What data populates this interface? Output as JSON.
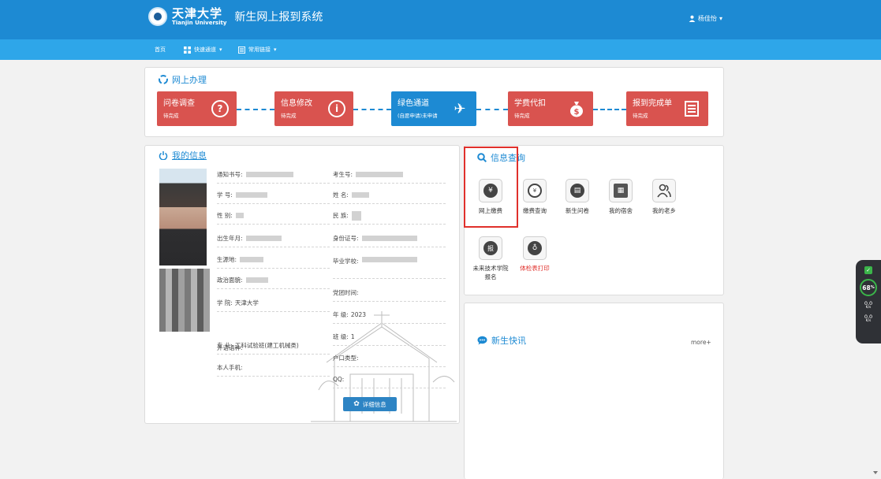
{
  "header": {
    "logo_cn": "天津大学",
    "logo_en": "Tianjin University",
    "system_title": "新生网上报到系统",
    "user_name": "杨佳怡"
  },
  "nav": {
    "home": "首页",
    "quick": "快速通道",
    "links": "常用链接"
  },
  "online": {
    "title": "网上办理",
    "steps": [
      {
        "label": "问卷调查",
        "status": "待完成",
        "icon": "question-icon",
        "color": "#d9534f"
      },
      {
        "label": "信息修改",
        "status": "待完成",
        "icon": "info-icon",
        "color": "#d9534f"
      },
      {
        "label": "绿色通道",
        "status": "(自愿申请)未申请",
        "icon": "airplane-icon",
        "color": "#1d8ad3"
      },
      {
        "label": "学费代扣",
        "status": "待完成",
        "icon": "money-bag-icon",
        "color": "#d9534f"
      },
      {
        "label": "报到完成单",
        "status": "待完成",
        "icon": "list-icon",
        "color": "#d9534f"
      }
    ]
  },
  "myinfo": {
    "title": "我的信息",
    "left_fields": [
      {
        "label": "通知书号:",
        "value": ""
      },
      {
        "label": "学 号:",
        "value": ""
      },
      {
        "label": "性 别:",
        "value": ""
      },
      {
        "label": "出生年月:",
        "value": ""
      },
      {
        "label": "生源地:",
        "value": ""
      },
      {
        "label": "政治面貌:",
        "value": ""
      },
      {
        "label": "学 院:",
        "value": "天津大学"
      },
      {
        "label": "专 业:",
        "value": "工科试验班(建工机械类)"
      },
      {
        "label": "外语语种:",
        "value": ""
      },
      {
        "label": "本人手机:",
        "value": ""
      }
    ],
    "right_fields": [
      {
        "label": "考生号:",
        "value": ""
      },
      {
        "label": "姓 名:",
        "value": ""
      },
      {
        "label": "民 族:",
        "value": ""
      },
      {
        "label": "身份证号:",
        "value": ""
      },
      {
        "label": "毕业学校:",
        "value": ""
      },
      {
        "label": "党团时间:",
        "value": ""
      },
      {
        "label": "年 级:",
        "value": "2023"
      },
      {
        "label": "班 级:",
        "value": "1"
      },
      {
        "label": "户口类型:",
        "value": ""
      },
      {
        "label": "QQ:",
        "value": ""
      }
    ],
    "detail_button": "详细信息"
  },
  "query": {
    "title": "信息查询",
    "services": [
      {
        "label": "网上缴费",
        "icon": "yen-coin-icon",
        "label_color": "#333333"
      },
      {
        "label": "缴费查询",
        "icon": "search-yen-icon",
        "label_color": "#333333"
      },
      {
        "label": "新生问卷",
        "icon": "document-icon",
        "label_color": "#333333"
      },
      {
        "label": "我的宿舍",
        "icon": "building-icon",
        "label_color": "#333333"
      },
      {
        "label": "我的老乡",
        "icon": "people-icon",
        "label_color": "#333333"
      },
      {
        "label": "未来技术学院报名",
        "icon": "signup-icon",
        "label_color": "#333333"
      },
      {
        "label": "体检表打印",
        "icon": "stethoscope-icon",
        "label_color": "#e0302b"
      }
    ]
  },
  "news": {
    "title": "新生快讯",
    "more": "more+"
  },
  "widget": {
    "percent": "68",
    "percent_unit": "%",
    "up_value": "0.0",
    "up_unit": "K/s",
    "down_value": "0.0",
    "down_unit": "K/s"
  },
  "colors": {
    "header": "#1d8ad3",
    "nav": "#2ea6e9",
    "step_red": "#d9534f",
    "highlight": "#e0302b"
  }
}
